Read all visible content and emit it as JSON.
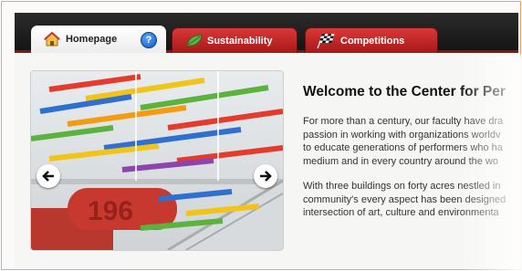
{
  "tabs": {
    "home": {
      "label": "Homepage",
      "icon": "house-icon"
    },
    "help": {
      "icon": "help-icon",
      "glyph": "?"
    },
    "sustainability": {
      "label": "Sustainability",
      "icon": "leaf-icon"
    },
    "competitions": {
      "label": "Competitions",
      "icon": "checkered-flag-icon"
    }
  },
  "slider": {
    "prev_icon": "arrow-left-icon",
    "next_icon": "arrow-right-icon",
    "image_text": "196"
  },
  "intro": {
    "title": "Welcome to the Center for Per",
    "paragraph1_lines": [
      "For more than a century, our faculty have dra",
      "passion in working with organizations worldv",
      "to educate generations of performers who ha",
      "medium and in every country around the wo"
    ],
    "paragraph2_lines": [
      "With three buildings on forty acres nestled in",
      "community's every aspect has been designed",
      "intersection of art, culture and environmenta"
    ]
  },
  "colors": {
    "border": "#f0a070",
    "tabbar": "#1c1c1c",
    "tab_red": "#c02323",
    "help_blue": "#1f6fd6"
  }
}
